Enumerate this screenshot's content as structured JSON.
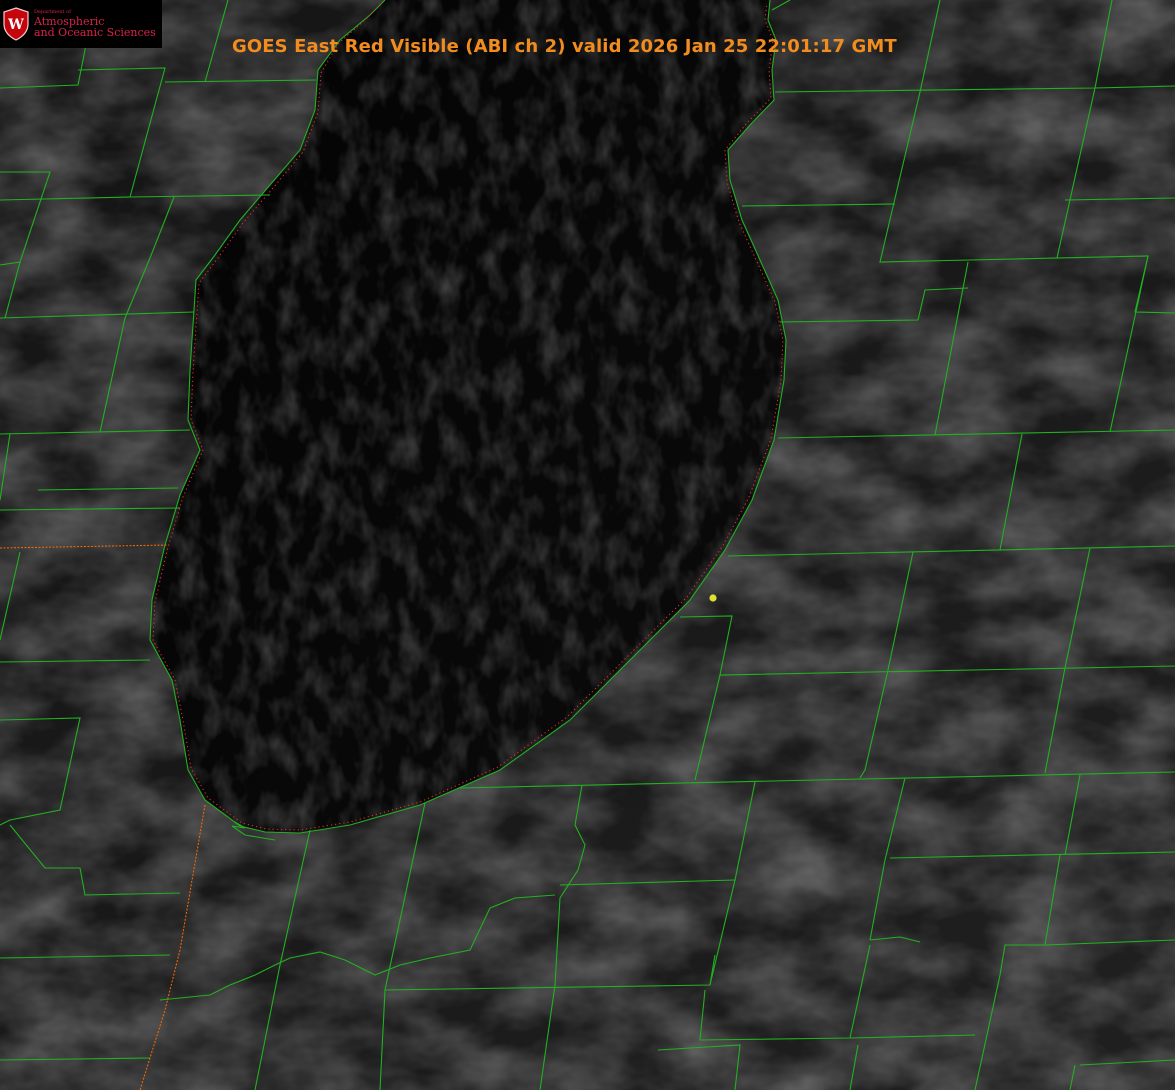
{
  "header": {
    "title": "GOES East Red Visible (ABI ch 2) valid 2026 Jan 25 22:01:17 GMT"
  },
  "logo": {
    "department_label": "Department of",
    "line1": "Atmospheric",
    "line2": "and Oceanic Sciences",
    "crest_letter": "W"
  },
  "colors": {
    "background": "#000000",
    "county_lines": "#22b022",
    "state_border": "#ff6a00",
    "shoreline_dots": "#ff2a2a",
    "title": "#f28c1f",
    "marker": "#e0e030",
    "logo_text": "#d9224a"
  },
  "map": {
    "feature": "lake-shaded-dark-with-cloud-texture",
    "marker_icon": "yellow-dot-icon"
  }
}
